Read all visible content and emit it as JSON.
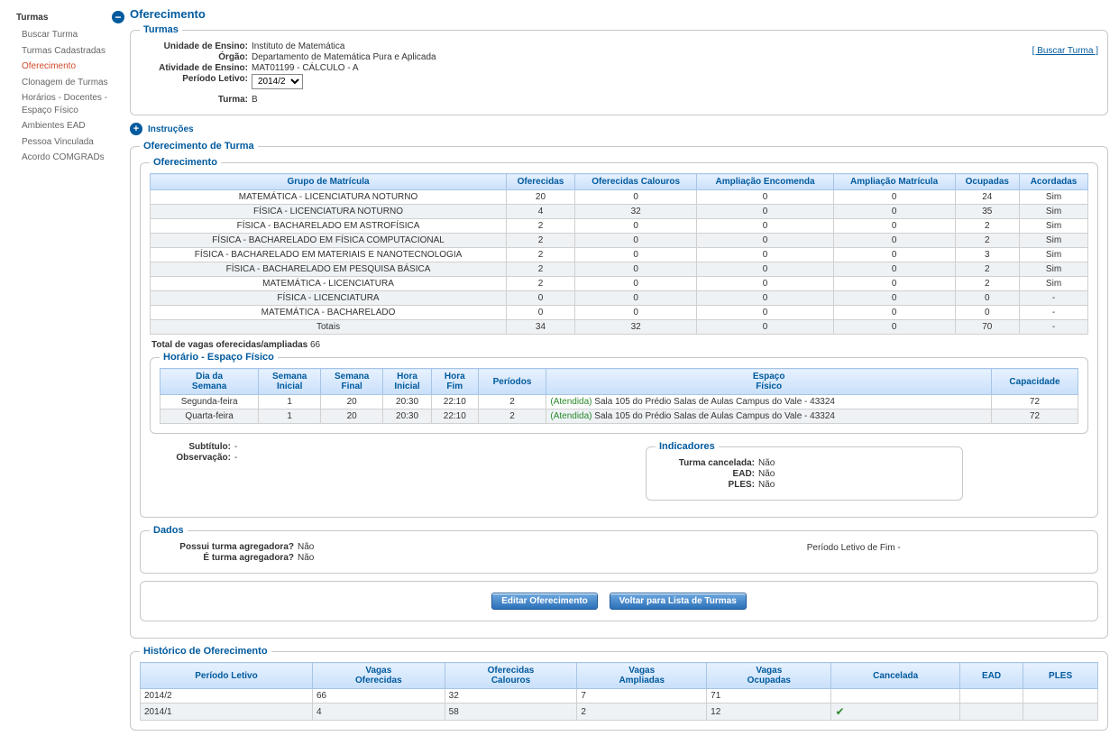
{
  "sidebar": {
    "title": "Turmas",
    "items": [
      {
        "label": "Buscar Turma",
        "active": false
      },
      {
        "label": "Turmas Cadastradas",
        "active": false
      },
      {
        "label": "Oferecimento",
        "active": true
      },
      {
        "label": "Clonagem de Turmas",
        "active": false
      },
      {
        "label": "Horários - Docentes - Espaço Físico",
        "active": false
      },
      {
        "label": "Ambientes EAD",
        "active": false
      },
      {
        "label": "Pessoa Vinculada",
        "active": false
      },
      {
        "label": "Acordo COMGRADs",
        "active": false
      }
    ]
  },
  "page_title": "Oferecimento",
  "top_link_label": "[ Buscar Turma ]",
  "turmas_box": {
    "legend": "Turmas",
    "fields": {
      "unidade_label": "Unidade de Ensino:",
      "unidade": "Instituto de Matemática",
      "orgao_label": "Órgão:",
      "orgao": "Departamento de Matemática Pura e Aplicada",
      "atividade_label": "Atividade de Ensino:",
      "atividade": "MAT01199 - CÁLCULO - A",
      "periodo_label": "Período Letivo:",
      "periodo_selected": "2014/2",
      "turma_label": "Turma:",
      "turma": "B"
    }
  },
  "instrucoes_label": "Instruções",
  "ofer_turma_legend": "Oferecimento de Turma",
  "ofer_legend": "Oferecimento",
  "ofer_table": {
    "headers": [
      "Grupo de Matrícula",
      "Oferecidas",
      "Oferecidas Calouros",
      "Ampliação Encomenda",
      "Ampliação Matrícula",
      "Ocupadas",
      "Acordadas"
    ],
    "rows": [
      [
        "MATEMÁTICA - LICENCIATURA NOTURNO",
        "20",
        "0",
        "0",
        "0",
        "24",
        "Sim"
      ],
      [
        "FÍSICA - LICENCIATURA NOTURNO",
        "4",
        "32",
        "0",
        "0",
        "35",
        "Sim"
      ],
      [
        "FÍSICA - BACHARELADO EM ASTROFÍSICA",
        "2",
        "0",
        "0",
        "0",
        "2",
        "Sim"
      ],
      [
        "FÍSICA - BACHARELADO EM FÍSICA COMPUTACIONAL",
        "2",
        "0",
        "0",
        "0",
        "2",
        "Sim"
      ],
      [
        "FÍSICA - BACHARELADO EM MATERIAIS E NANOTECNOLOGIA",
        "2",
        "0",
        "0",
        "0",
        "3",
        "Sim"
      ],
      [
        "FÍSICA - BACHARELADO EM PESQUISA BÁSICA",
        "2",
        "0",
        "0",
        "0",
        "2",
        "Sim"
      ],
      [
        "MATEMÁTICA - LICENCIATURA",
        "2",
        "0",
        "0",
        "0",
        "2",
        "Sim"
      ],
      [
        "FÍSICA - LICENCIATURA",
        "0",
        "0",
        "0",
        "0",
        "0",
        "-"
      ],
      [
        "MATEMÁTICA - BACHARELADO",
        "0",
        "0",
        "0",
        "0",
        "0",
        "-"
      ]
    ],
    "totals": [
      "Totais",
      "34",
      "32",
      "0",
      "0",
      "70",
      "-"
    ]
  },
  "total_vagas_label": "Total de vagas oferecidas/ampliadas",
  "total_vagas_value": "66",
  "horario_legend": "Horário - Espaço Físico",
  "horario_table": {
    "headers": [
      "Dia da\nSemana",
      "Semana\nInicial",
      "Semana\nFinal",
      "Hora\nInicial",
      "Hora\nFim",
      "Períodos",
      "Espaço\nFísico",
      "Capacidade"
    ],
    "rows": [
      {
        "dia": "Segunda-feira",
        "si": "1",
        "sf": "20",
        "hi": "20:30",
        "hf": "22:10",
        "per": "2",
        "status": "(Atendida)",
        "espaco": "Sala 105 do Prédio Salas de Aulas Campus do Vale - 43324",
        "cap": "72"
      },
      {
        "dia": "Quarta-feira",
        "si": "1",
        "sf": "20",
        "hi": "20:30",
        "hf": "22:10",
        "per": "2",
        "status": "(Atendida)",
        "espaco": "Sala 105 do Prédio Salas de Aulas Campus do Vale - 43324",
        "cap": "72"
      }
    ]
  },
  "subtitulo": {
    "label": "Subtítulo:",
    "value": "-"
  },
  "observacao": {
    "label": "Observação:",
    "value": "-"
  },
  "indicadores": {
    "legend": "Indicadores",
    "cancelada": {
      "label": "Turma cancelada:",
      "value": "Não"
    },
    "ead": {
      "label": "EAD:",
      "value": "Não"
    },
    "ples": {
      "label": "PLES:",
      "value": "Não"
    }
  },
  "dados": {
    "legend": "Dados",
    "agregadora": {
      "label": "Possui turma agregadora?",
      "value": "Não"
    },
    "e_agregadora": {
      "label": "É turma agregadora?",
      "value": "Não"
    },
    "periodo_fim": {
      "label": "Período Letivo de Fim",
      "value": "-"
    }
  },
  "buttons": {
    "editar": "Editar Oferecimento",
    "voltar": "Voltar para Lista de Turmas"
  },
  "historico": {
    "legend": "Histórico de Oferecimento",
    "headers": [
      "Período Letivo",
      "Vagas\nOferecidas",
      "Oferecidas\nCalouros",
      "Vagas\nAmpliadas",
      "Vagas\nOcupadas",
      "Cancelada",
      "EAD",
      "PLES"
    ],
    "rows": [
      {
        "cells": [
          "2014/2",
          "66",
          "32",
          "7",
          "71",
          "",
          "",
          ""
        ]
      },
      {
        "cells": [
          "2014/1",
          "4",
          "58",
          "2",
          "12",
          "✔",
          "",
          ""
        ]
      }
    ]
  }
}
